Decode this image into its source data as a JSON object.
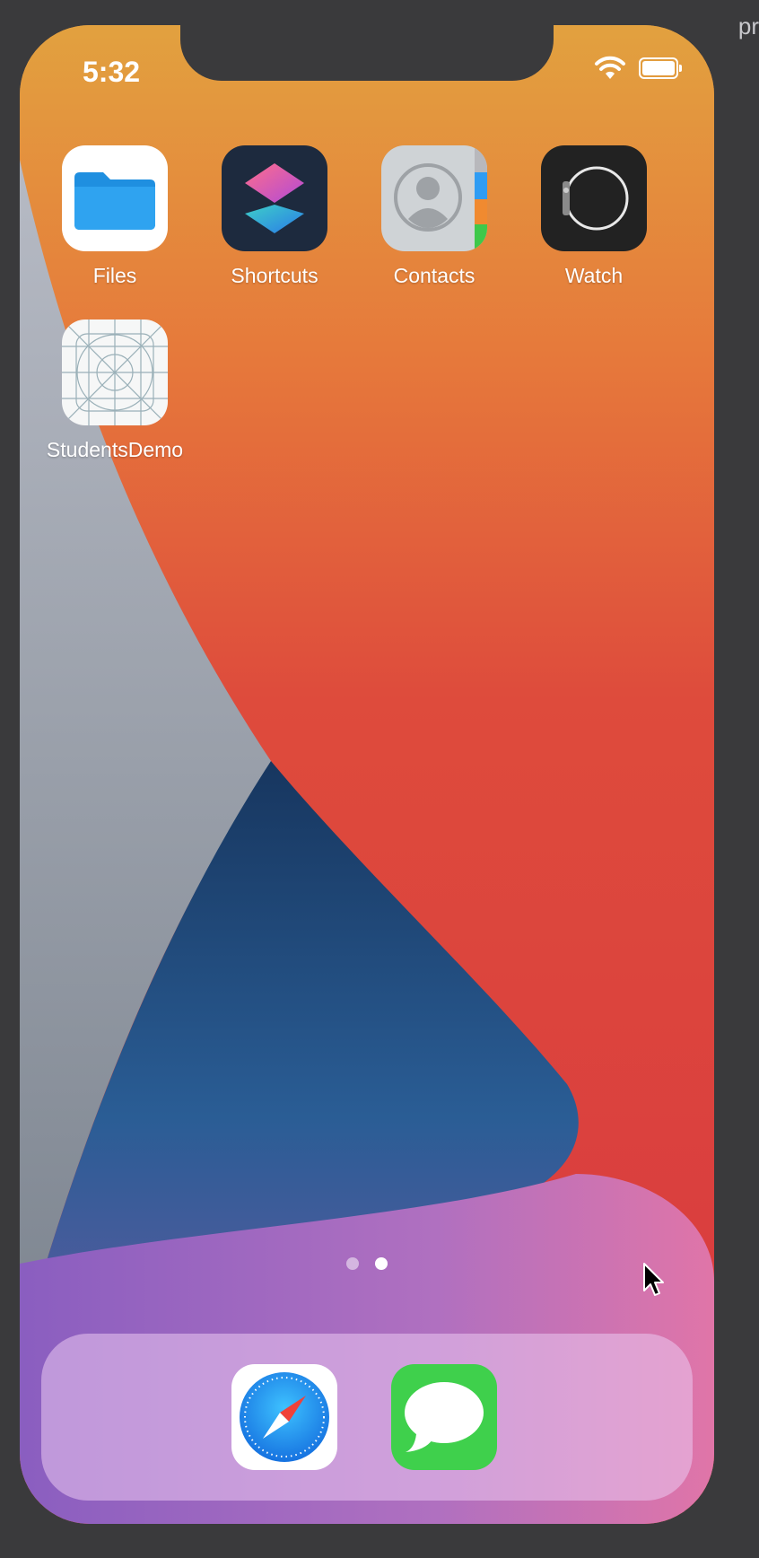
{
  "backdrop": {
    "edge_text": "pr"
  },
  "status_bar": {
    "time": "5:32",
    "icons": [
      "wifi-icon",
      "battery-icon"
    ],
    "battery_level": 1.0
  },
  "home_screen": {
    "apps": [
      {
        "name": "files",
        "label": "Files",
        "icon": "folder-icon"
      },
      {
        "name": "shortcuts",
        "label": "Shortcuts",
        "icon": "shortcuts-icon"
      },
      {
        "name": "contacts",
        "label": "Contacts",
        "icon": "contacts-icon"
      },
      {
        "name": "watch",
        "label": "Watch",
        "icon": "watch-icon"
      },
      {
        "name": "students-demo",
        "label": "StudentsDemo",
        "icon": "blank-app-grid-icon"
      }
    ],
    "page_count": 2,
    "current_page": 2
  },
  "dock": {
    "apps": [
      {
        "name": "safari",
        "icon": "compass-icon"
      },
      {
        "name": "messages",
        "icon": "speech-bubble-icon"
      }
    ]
  },
  "colors": {
    "wallpaper_top": "#e2a03f",
    "wallpaper_red": "#d9403f",
    "wallpaper_navy": "#1c4470",
    "wallpaper_gray": "#a3aab8",
    "files_blue": "#2196e8",
    "messages_green": "#3fd04c",
    "safari_blue": "#1a8ee6"
  }
}
